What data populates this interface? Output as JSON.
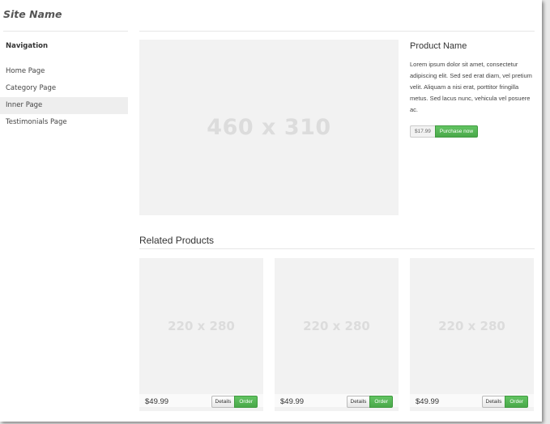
{
  "site": {
    "name": "Site Name"
  },
  "sidebar": {
    "title": "Navigation",
    "items": [
      {
        "label": "Home Page",
        "active": false
      },
      {
        "label": "Category Page",
        "active": false
      },
      {
        "label": "Inner Page",
        "active": true
      },
      {
        "label": "Testimonials Page",
        "active": false
      }
    ]
  },
  "product": {
    "image_label": "460 x 310",
    "name": "Product Name",
    "description": "Lorem ipsum dolor sit amet, consectetur adipiscing elit. Sed sed erat diam, vel pretium velit. Aliquam a nisi erat, porttitor fringilla metus. Sed lacus nunc, vehicula vel posuere ac.",
    "price": "$17.99",
    "purchase_label": "Purchase now"
  },
  "related": {
    "title": "Related Products",
    "items": [
      {
        "image_label": "220 x 280",
        "price": "$49.99",
        "details_label": "Details",
        "order_label": "Order"
      },
      {
        "image_label": "220 x 280",
        "price": "$49.99",
        "details_label": "Details",
        "order_label": "Order"
      },
      {
        "image_label": "220 x 280",
        "price": "$49.99",
        "details_label": "Details",
        "order_label": "Order"
      }
    ]
  },
  "colors": {
    "accent_green": "#5bb75b",
    "placeholder_bg": "#f2f2f2",
    "active_nav_bg": "#eeeeee"
  }
}
